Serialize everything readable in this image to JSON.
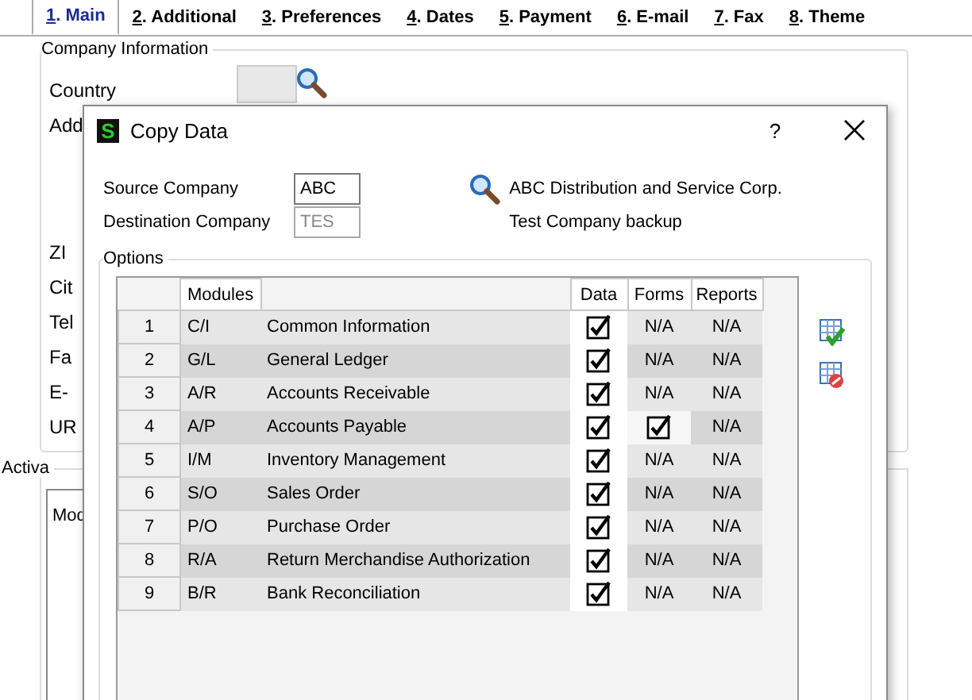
{
  "tabs": [
    {
      "key": "1",
      "label": ". Main",
      "selected": true
    },
    {
      "key": "2",
      "label": ". Additional",
      "selected": false
    },
    {
      "key": "3",
      "label": ". Preferences",
      "selected": false
    },
    {
      "key": "4",
      "label": ". Dates",
      "selected": false
    },
    {
      "key": "5",
      "label": ". Payment",
      "selected": false
    },
    {
      "key": "6",
      "label": ". E-mail",
      "selected": false
    },
    {
      "key": "7",
      "label": ". Fax",
      "selected": false
    },
    {
      "key": "8",
      "label": ". Theme",
      "selected": false
    }
  ],
  "company_information": {
    "title": "Company Information",
    "labels": [
      "Country",
      "Add",
      "ZI",
      "Cit",
      "Tel",
      "Fa",
      "E-",
      "UR"
    ]
  },
  "activation": {
    "title": "Activa",
    "column_1": "Mod"
  },
  "dialog": {
    "logo": "S",
    "title": "Copy Data",
    "help": "?",
    "source_company": {
      "label": "Source Company",
      "value": "ABC",
      "name": "ABC Distribution and Service Corp."
    },
    "destination_company": {
      "label": "Destination Company",
      "value": "TES",
      "name": "Test Company backup",
      "disabled": true
    },
    "options": {
      "title": "Options",
      "columns": [
        "Modules",
        "Data",
        "Forms",
        "Reports"
      ],
      "rows": [
        {
          "number": "1",
          "code": "C/I",
          "module": "Common Information",
          "data": true,
          "forms": {
            "kind": "text",
            "text": "N/A"
          },
          "reports": "N/A"
        },
        {
          "number": "2",
          "code": "G/L",
          "module": "General Ledger",
          "data": true,
          "forms": {
            "kind": "text",
            "text": "N/A"
          },
          "reports": "N/A"
        },
        {
          "number": "3",
          "code": "A/R",
          "module": "Accounts Receivable",
          "data": true,
          "forms": {
            "kind": "text",
            "text": "N/A"
          },
          "reports": "N/A"
        },
        {
          "number": "4",
          "code": "A/P",
          "module": "Accounts Payable",
          "data": true,
          "forms": {
            "kind": "checkbox",
            "checked": true
          },
          "reports": "N/A"
        },
        {
          "number": "5",
          "code": "I/M",
          "module": "Inventory Management",
          "data": true,
          "forms": {
            "kind": "text",
            "text": "N/A"
          },
          "reports": "N/A"
        },
        {
          "number": "6",
          "code": "S/O",
          "module": "Sales Order",
          "data": true,
          "forms": {
            "kind": "text",
            "text": "N/A"
          },
          "reports": "N/A"
        },
        {
          "number": "7",
          "code": "P/O",
          "module": "Purchase Order",
          "data": true,
          "forms": {
            "kind": "text",
            "text": "N/A"
          },
          "reports": "N/A"
        },
        {
          "number": "8",
          "code": "R/A",
          "module": "Return Merchandise Authorization",
          "data": true,
          "forms": {
            "kind": "text",
            "text": "N/A"
          },
          "reports": "N/A"
        },
        {
          "number": "9",
          "code": "B/R",
          "module": "Bank Reconciliation",
          "data": true,
          "forms": {
            "kind": "text",
            "text": "N/A"
          },
          "reports": "N/A"
        }
      ]
    }
  }
}
